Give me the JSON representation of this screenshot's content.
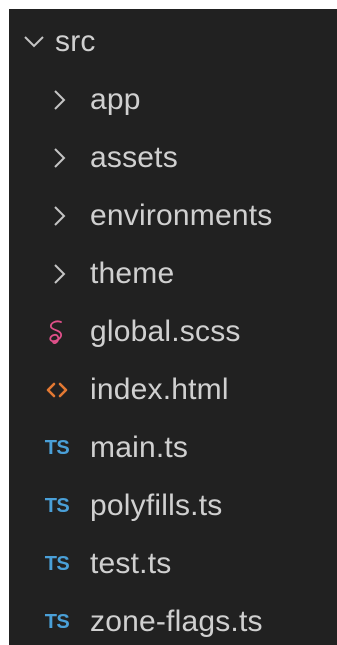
{
  "explorer": {
    "root": {
      "label": "src",
      "icon": "chevron-down-icon",
      "expanded": true
    },
    "folders": [
      {
        "label": "app",
        "icon": "chevron-right-icon"
      },
      {
        "label": "assets",
        "icon": "chevron-right-icon"
      },
      {
        "label": "environments",
        "icon": "chevron-right-icon"
      },
      {
        "label": "theme",
        "icon": "chevron-right-icon"
      }
    ],
    "files": [
      {
        "label": "global.scss",
        "icon": "sass-file-icon",
        "color": "#e0508a"
      },
      {
        "label": "index.html",
        "icon": "html-file-icon",
        "color": "#e37933"
      },
      {
        "label": "main.ts",
        "icon": "typescript-file-icon",
        "badge": "TS",
        "color": "#4aa0d8"
      },
      {
        "label": "polyfills.ts",
        "icon": "typescript-file-icon",
        "badge": "TS",
        "color": "#4aa0d8"
      },
      {
        "label": "test.ts",
        "icon": "typescript-file-icon",
        "badge": "TS",
        "color": "#4aa0d8"
      },
      {
        "label": "zone-flags.ts",
        "icon": "typescript-file-icon",
        "badge": "TS",
        "color": "#4aa0d8"
      }
    ],
    "colors": {
      "background": "#212121",
      "text": "#d0d0d0",
      "chevron": "#c5c5c5"
    }
  }
}
